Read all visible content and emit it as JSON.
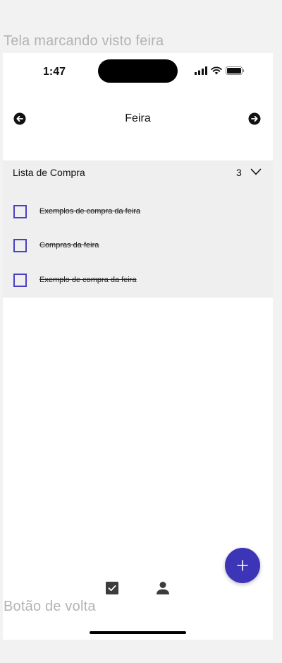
{
  "frame": {
    "top_label": "Tela marcando visto feira",
    "bottom_label": "Botão de volta"
  },
  "status_bar": {
    "time": "1:47",
    "icons": [
      "signal-bars-icon",
      "wifi-icon",
      "battery-icon"
    ]
  },
  "header": {
    "title": "Feira",
    "back_icon": "arrow-left-circle-icon",
    "forward_icon": "arrow-right-circle-icon"
  },
  "list": {
    "title": "Lista de Compra",
    "count": "3",
    "chevron_icon": "chevron-down-icon",
    "items": [
      {
        "label": "Exemplos de compra da feira",
        "checked": false,
        "struck": true
      },
      {
        "label": "Compras da feira",
        "checked": false,
        "struck": true
      },
      {
        "label": "Exemplo de compra da feira",
        "checked": false,
        "struck": true
      }
    ]
  },
  "fab": {
    "icon": "plus-icon"
  },
  "bottom_nav": {
    "tabs": [
      {
        "icon": "check-square-icon"
      },
      {
        "icon": "person-icon"
      }
    ]
  },
  "colors": {
    "accent": "#4b3fc4",
    "fab": "#3d35b8",
    "section_bg": "#efefef",
    "page_bg": "#ffffff",
    "outer_bg": "#f2f2f2",
    "frame_label": "#b3b3b3"
  }
}
